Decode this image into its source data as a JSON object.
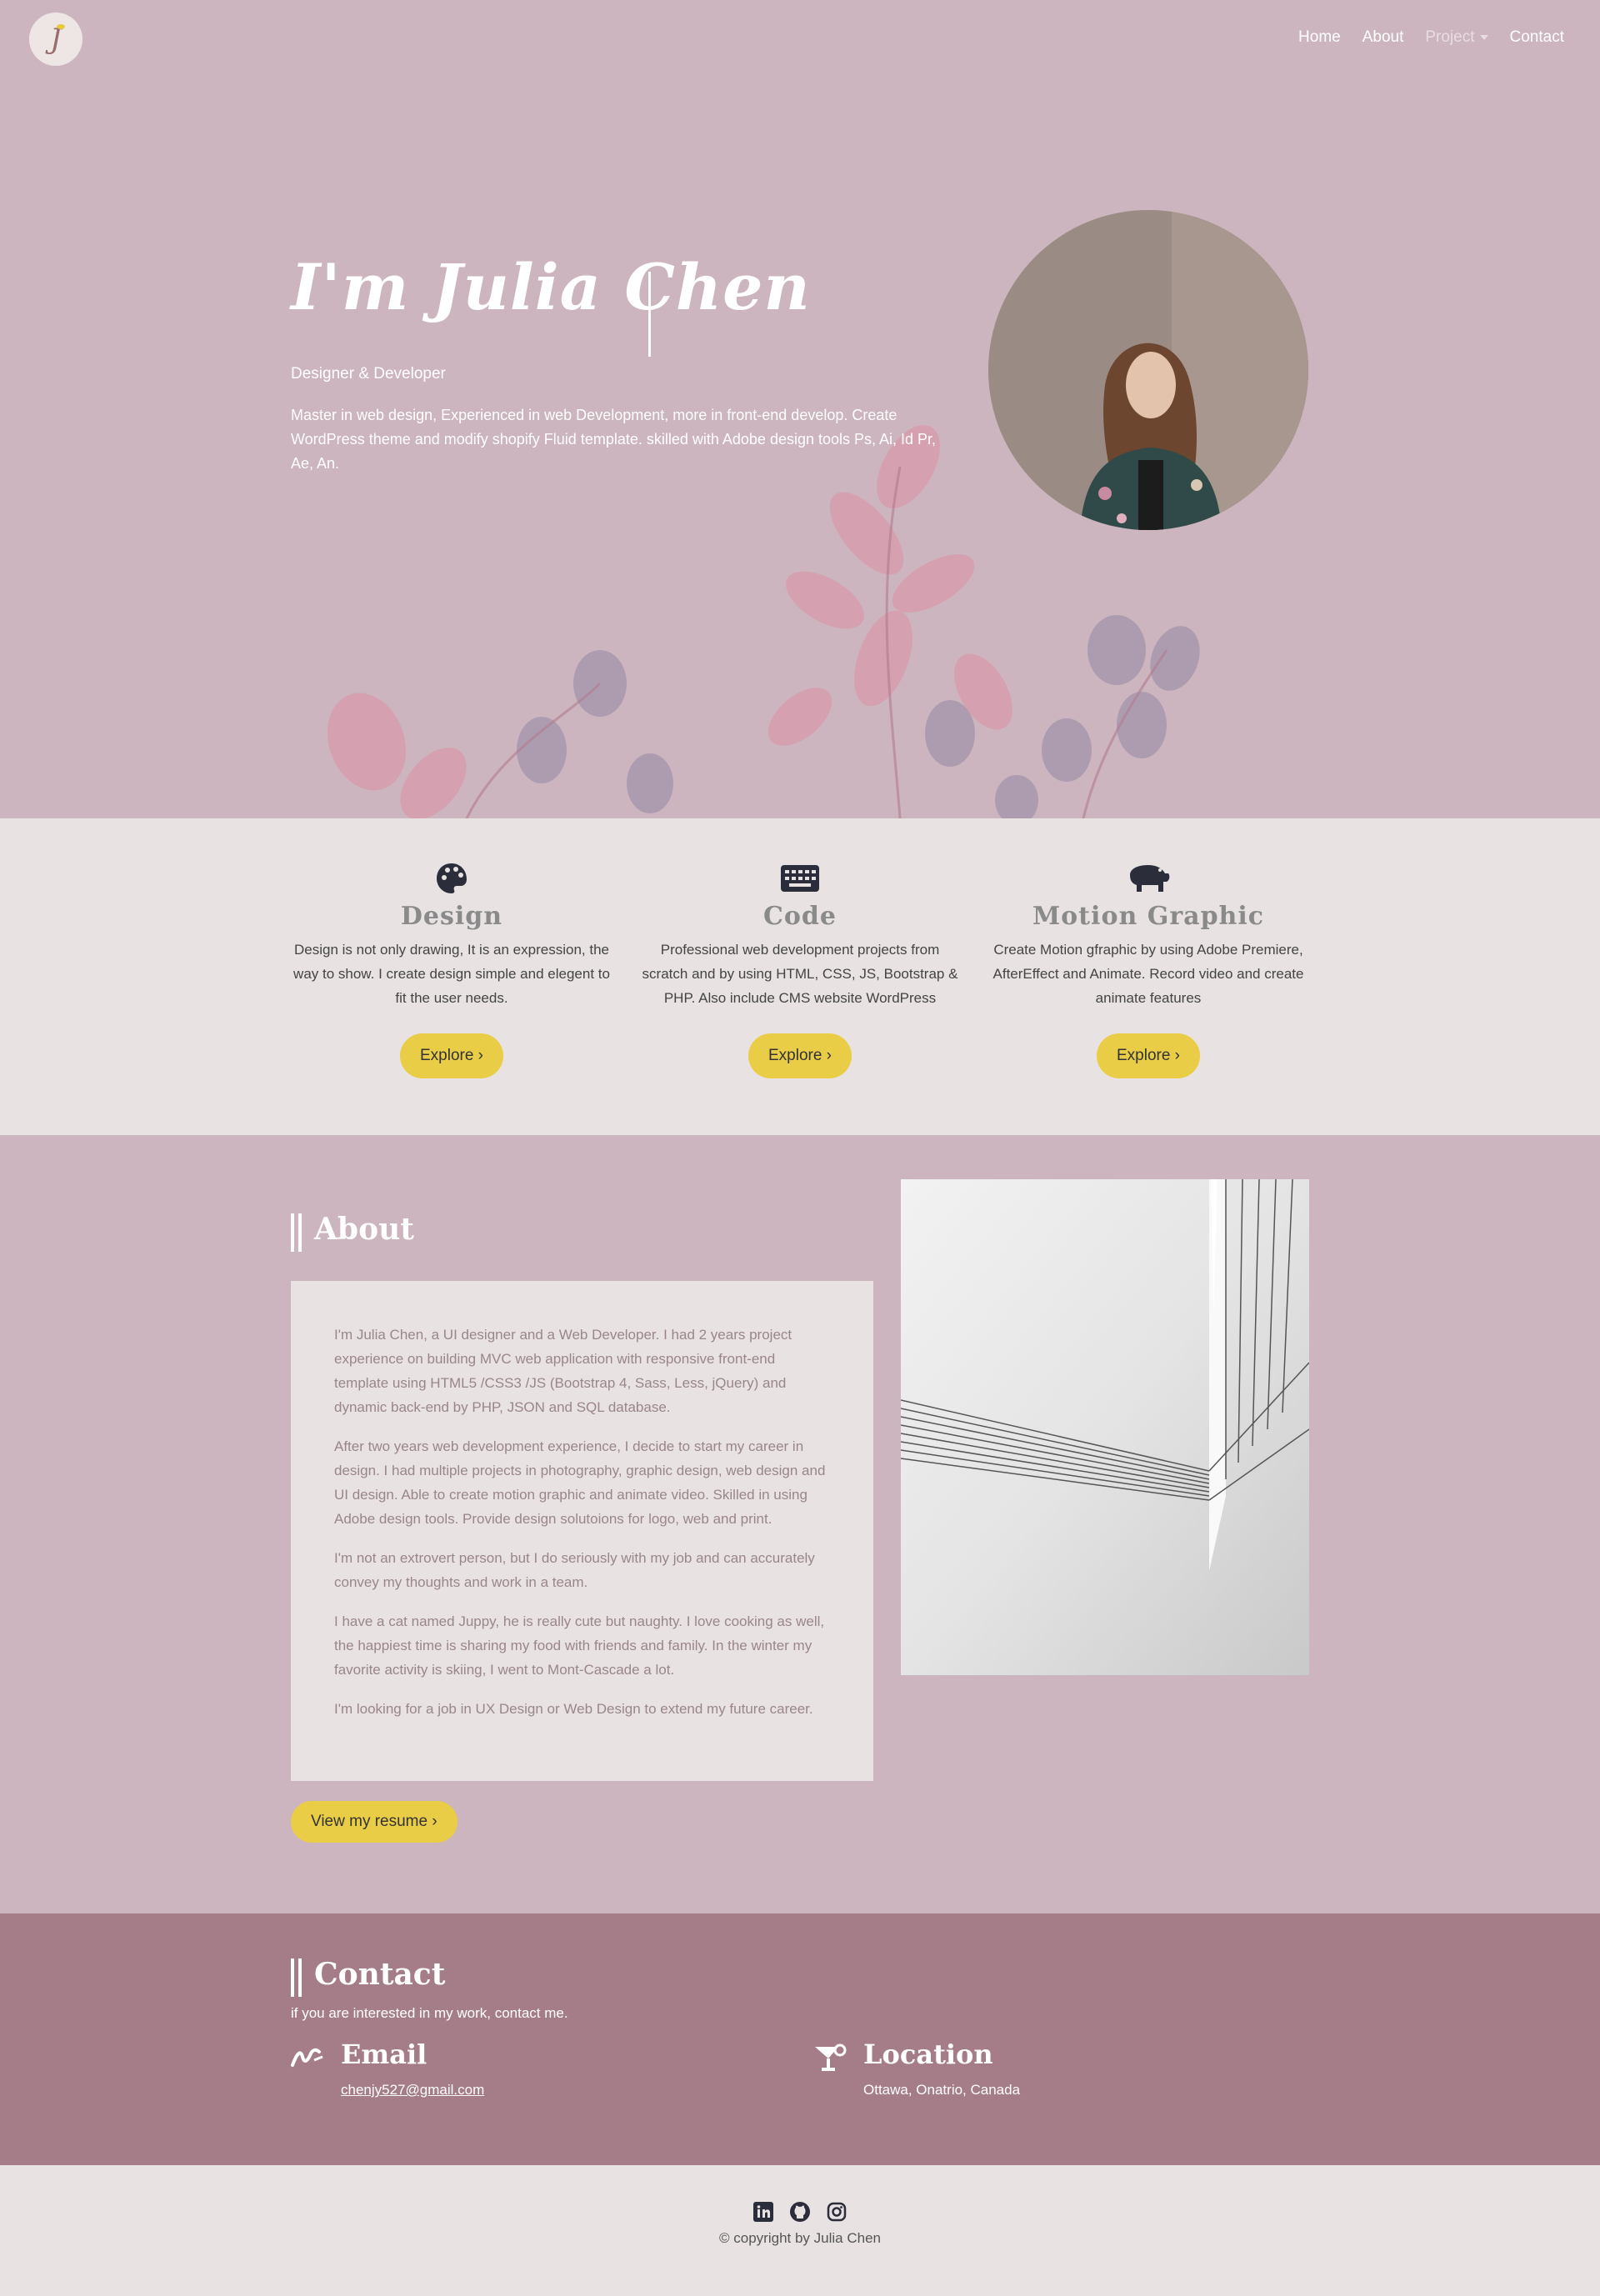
{
  "nav": {
    "logo_letter": "J",
    "links": [
      {
        "label": "Home"
      },
      {
        "label": "About"
      },
      {
        "label": "Project"
      },
      {
        "label": "Contact"
      }
    ]
  },
  "hero": {
    "title": "I'm Julia Chen",
    "subtitle": "Designer & Developer",
    "description": "Master in web design, Experienced in web Development, more in front-end develop. Create WordPress theme and modify shopify Fluid template. skilled with Adobe design tools Ps, Ai, Id Pr, Ae, An."
  },
  "services": [
    {
      "icon": "palette-icon",
      "title": "Design",
      "text": "Design is not only drawing, It is an expression, the way to show. I create design simple and elegent to fit the user needs.",
      "button": "Explore"
    },
    {
      "icon": "keyboard-icon",
      "title": "Code",
      "text": "Professional web development projects from scratch and by using HTML, CSS, JS, Bootstrap & PHP. Also include CMS website WordPress",
      "button": "Explore"
    },
    {
      "icon": "hippo-icon",
      "title": "Motion Graphic",
      "text": "Create Motion gfraphic by using Adobe Premiere, AfterEffect and Animate. Record video and create animate features",
      "button": "Explore"
    }
  ],
  "about": {
    "title": "About",
    "paragraphs": [
      "I'm Julia Chen, a UI designer and a Web Developer. I had 2 years project experience on building MVC web application with responsive front-end template using HTML5 /CSS3 /JS (Bootstrap 4, Sass, Less, jQuery) and dynamic back-end by PHP, JSON and SQL database.",
      "After two years web development experience, I decide to start my career in design. I had multiple projects in photography, graphic design, web design and UI design. Able to create motion graphic and animate video. Skilled in using Adobe design tools. Provide design solutoions for logo, web and print.",
      "I'm not an extrovert person, but I do seriously with my job and can accurately convey my thoughts and work in a team.",
      "I have a cat named Juppy, he is really cute but naughty. I love cooking as well, the happiest time is sharing my food with friends and family. In the winter my favorite activity is skiing, I went to Mont-Cascade a lot.",
      "I'm looking for a job in UX Design or Web Design to extend my future career."
    ],
    "resume_button": "View my resume"
  },
  "contact": {
    "title": "Contact",
    "subtitle": "if you are interested in my work, contact me.",
    "email_label": "Email",
    "email": "chenjy527@gmail.com",
    "location_label": "Location",
    "location": "Ottawa, Onatrio, Canada"
  },
  "footer": {
    "socials": [
      "linkedin-icon",
      "github-icon",
      "instagram-icon"
    ],
    "copyright": "© copyright by Julia Chen"
  },
  "colors": {
    "hero_bg": "#ccb5be",
    "contact_bg": "#a57d89",
    "light_bg": "#e8e2e2",
    "accent": "#e9cd46"
  }
}
